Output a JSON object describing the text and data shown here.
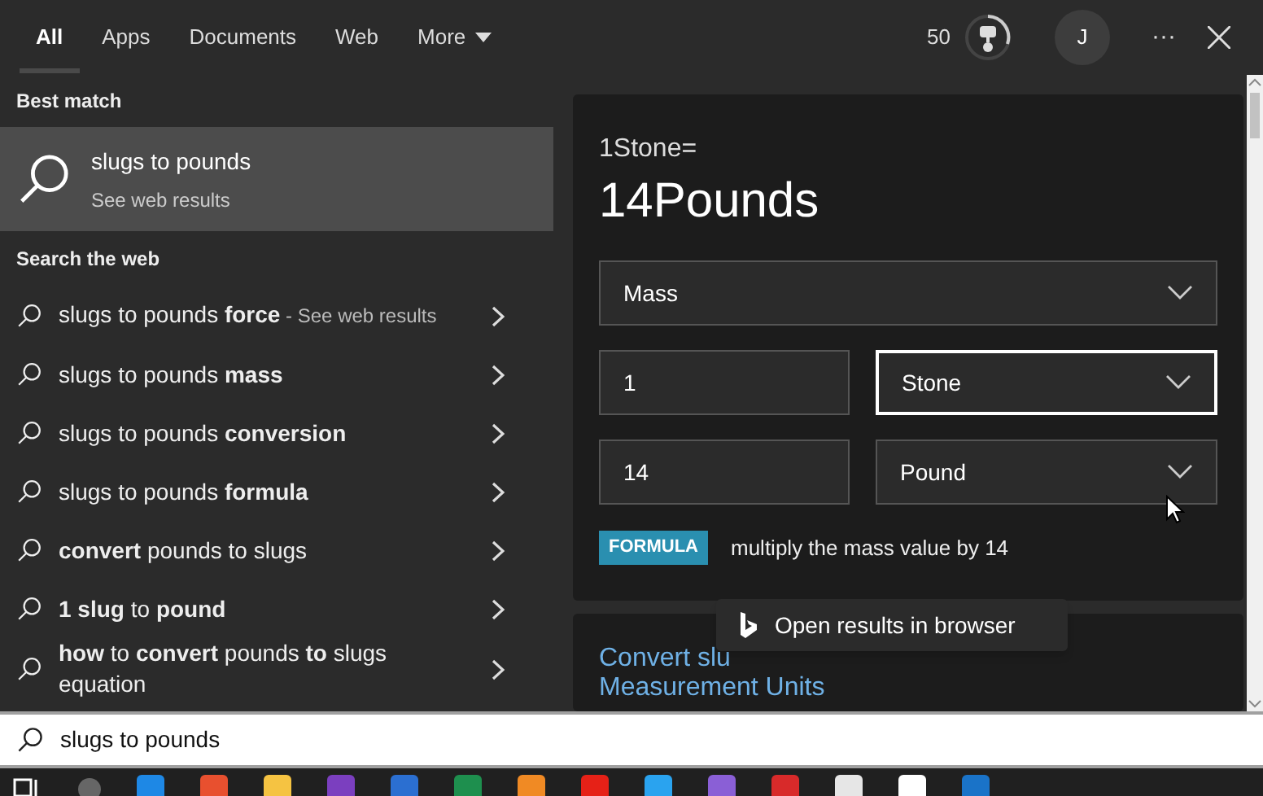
{
  "tabs": [
    {
      "label": "All",
      "selected": true
    },
    {
      "label": "Apps",
      "selected": false
    },
    {
      "label": "Documents",
      "selected": false
    },
    {
      "label": "Web",
      "selected": false
    },
    {
      "label": "More",
      "selected": false,
      "dropdown": true
    }
  ],
  "header": {
    "points": "50",
    "avatar": "J",
    "more": "···"
  },
  "best_match": {
    "heading": "Best match",
    "title": "slugs to pounds",
    "subtitle": "See web results",
    "selected": true
  },
  "web": {
    "heading": "Search the web",
    "items": [
      {
        "text": "slugs to pounds **force**",
        "suffix": "- See web results"
      },
      {
        "text": "slugs to pounds **mass**"
      },
      {
        "text": "slugs to pounds **conversion**"
      },
      {
        "text": "slugs to pounds **formula**"
      },
      {
        "text": "**convert** pounds to slugs"
      },
      {
        "text": "**1 slug** to **pound**"
      },
      {
        "text": "**how** to **convert** pounds **to** slugs equation"
      }
    ]
  },
  "converter": {
    "equation": "1Stone=",
    "result": "14Pounds",
    "category": "Mass",
    "rows": [
      {
        "value": "1",
        "unit": "Stone",
        "focused": true
      },
      {
        "value": "14",
        "unit": "Pound",
        "focused": false
      }
    ],
    "badge": "FORMULA",
    "formula": "multiply the mass value by 14"
  },
  "result_card": {
    "title_line1": "Convert slu",
    "title_line2": "Measurement Units"
  },
  "tooltip": {
    "text": "Open results in browser"
  },
  "search": {
    "value": "slugs to pounds"
  },
  "taskbar": {
    "apps": [
      {
        "color": "#1e88e5"
      },
      {
        "color": "#e8502f"
      },
      {
        "color": "#f5c342"
      },
      {
        "color": "#7b3fbf"
      },
      {
        "color": "#2b6fd1"
      },
      {
        "color": "#1e8f4e"
      },
      {
        "color": "#f08a24"
      },
      {
        "color": "#e62117"
      },
      {
        "color": "#2aa3ef"
      },
      {
        "color": "#8a5fd6"
      },
      {
        "color": "#d82a2a"
      },
      {
        "color": "#e6e6e6"
      },
      {
        "color": "#ffffff"
      },
      {
        "color": "#1a73c8"
      }
    ]
  }
}
